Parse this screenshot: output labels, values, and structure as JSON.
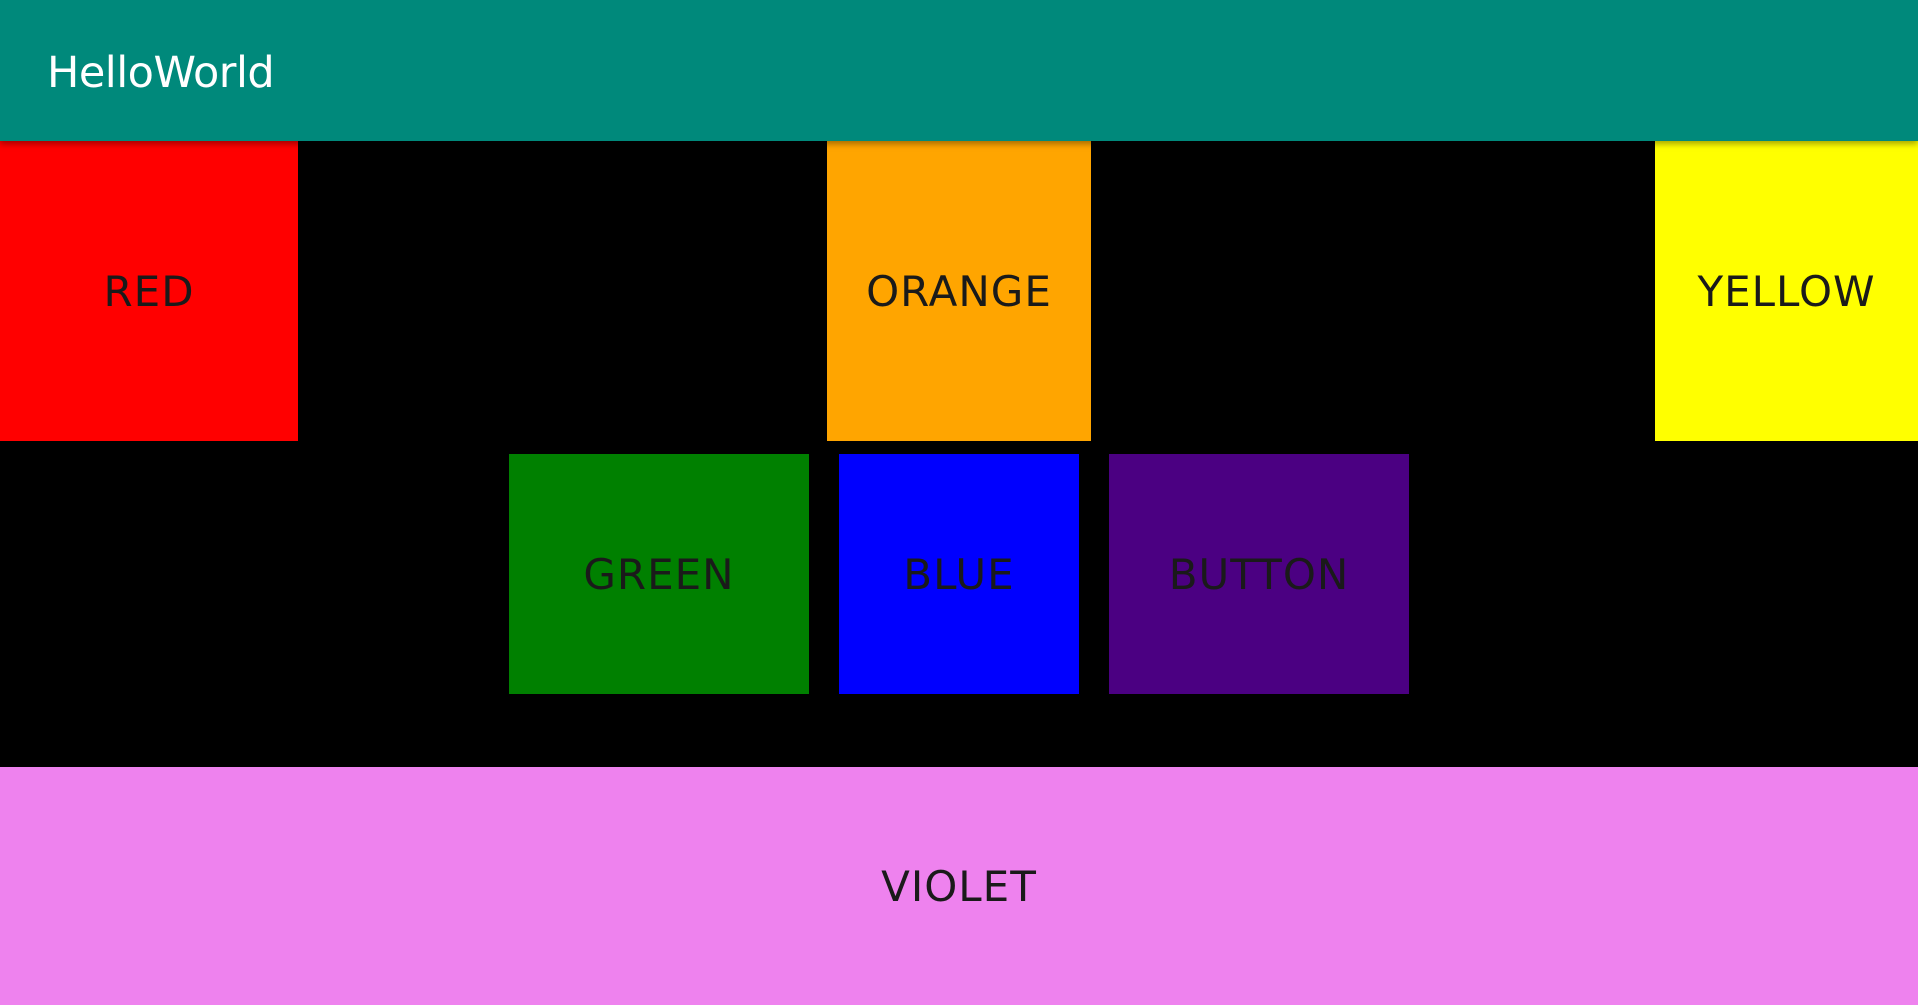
{
  "app_bar": {
    "title": "HelloWorld",
    "color": "#00897B"
  },
  "buttons": {
    "red": {
      "label": "RED",
      "color": "#FF0000"
    },
    "orange": {
      "label": "ORANGE",
      "color": "#FFA500"
    },
    "yellow": {
      "label": "YELLOW",
      "color": "#FFFF00"
    },
    "green": {
      "label": "GREEN",
      "color": "#008000"
    },
    "blue": {
      "label": "BLUE",
      "color": "#0000FF"
    },
    "button": {
      "label": "BUTTON",
      "color": "#4B0082"
    },
    "violet": {
      "label": "VIOLET",
      "color": "#EE82EE"
    }
  },
  "background_color": "#000000"
}
